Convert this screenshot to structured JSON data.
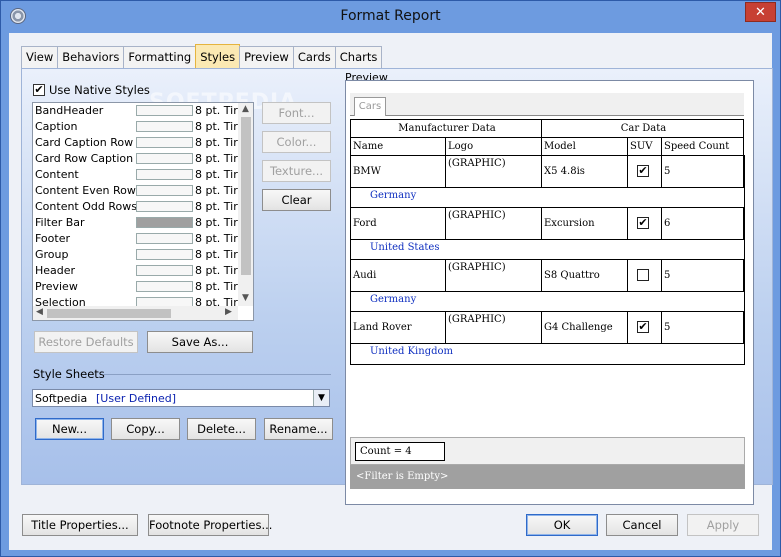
{
  "window": {
    "title": "Format Report",
    "close_glyph": "✕"
  },
  "tabs": [
    "View",
    "Behaviors",
    "Formatting",
    "Styles",
    "Preview",
    "Cards",
    "Charts"
  ],
  "active_tab": "Styles",
  "watermark": "SOFTPEDIA",
  "styles_panel": {
    "use_native_label": "Use Native Styles",
    "use_native_checked": true,
    "styles": [
      {
        "name": "BandHeader",
        "font": "8 pt. Tir"
      },
      {
        "name": "Caption",
        "font": "8 pt. Tir"
      },
      {
        "name": "Card Caption Row",
        "font": "8 pt. Tir"
      },
      {
        "name": "Card Row Caption",
        "font": "8 pt. Tir"
      },
      {
        "name": "Content",
        "font": "8 pt. Tir"
      },
      {
        "name": "Content Even Rows",
        "font": "8 pt. Tir"
      },
      {
        "name": "Content Odd Rows",
        "font": "8 pt. Tir"
      },
      {
        "name": "Filter Bar",
        "font": "8 pt. Tir"
      },
      {
        "name": "Footer",
        "font": "8 pt. Tir"
      },
      {
        "name": "Group",
        "font": "8 pt. Tir"
      },
      {
        "name": "Header",
        "font": "8 pt. Tir"
      },
      {
        "name": "Preview",
        "font": "8 pt. Tir"
      },
      {
        "name": "Selection",
        "font": "8 pt. Tir"
      }
    ],
    "side_buttons": {
      "font": "Font...",
      "color": "Color...",
      "texture": "Texture...",
      "clear": "Clear"
    },
    "restore_defaults": "Restore Defaults",
    "save_as": "Save As...",
    "style_sheets_label": "Style Sheets",
    "style_sheet_name": "Softpedia",
    "style_sheet_type": "[User Defined]",
    "sheet_buttons": {
      "new": "New...",
      "copy": "Copy...",
      "delete": "Delete...",
      "rename": "Rename..."
    }
  },
  "preview": {
    "label": "Preview",
    "tab": "Cars",
    "band_headers": [
      "Manufacturer Data",
      "Car Data"
    ],
    "columns": [
      "Name",
      "Logo",
      "Model",
      "SUV",
      "Speed Count"
    ],
    "rows": [
      {
        "name": "BMW",
        "logo": "(GRAPHIC)",
        "model": "X5 4.8is",
        "suv": "✔",
        "speed": "5",
        "country": "Germany"
      },
      {
        "name": "Ford",
        "logo": "(GRAPHIC)",
        "model": "Excursion",
        "suv": "✔",
        "speed": "6",
        "country": "United States"
      },
      {
        "name": "Audi",
        "logo": "(GRAPHIC)",
        "model": "S8 Quattro",
        "suv": "",
        "speed": "5",
        "country": "Germany"
      },
      {
        "name": "Land Rover",
        "logo": "(GRAPHIC)",
        "model": "G4 Challenge",
        "suv": "✔",
        "speed": "5",
        "country": "United Kingdom"
      }
    ],
    "count": "Count = 4",
    "filter": "<Filter is Empty>"
  },
  "bottom_buttons": {
    "title_props": "Title Properties...",
    "footnote_props": "Footnote Properties...",
    "ok": "OK",
    "cancel": "Cancel",
    "apply": "Apply"
  }
}
